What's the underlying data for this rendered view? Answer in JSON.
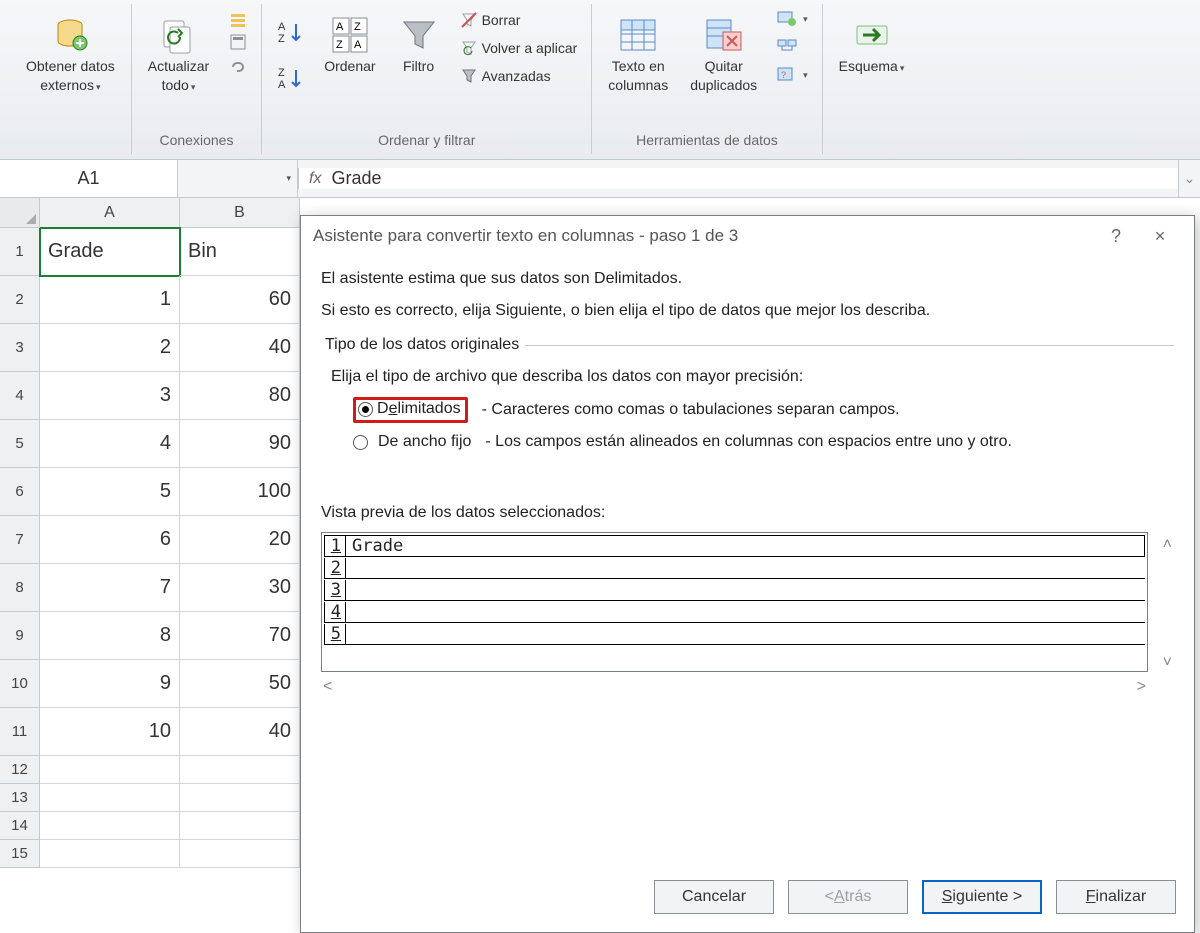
{
  "ribbon": {
    "get_external": {
      "label_l1": "Obtener datos",
      "label_l2": "externos"
    },
    "refresh": {
      "label_l1": "Actualizar",
      "label_l2": "todo"
    },
    "connections_group": "Conexiones",
    "sort_asc": "A↓Z",
    "sort_desc": "Z↓A",
    "sort_btn": "Ordenar",
    "filter_btn": "Filtro",
    "clear": "Borrar",
    "reapply": "Volver a aplicar",
    "advanced": "Avanzadas",
    "sortfilter_group": "Ordenar y filtrar",
    "text_to_cols_l1": "Texto en",
    "text_to_cols_l2": "columnas",
    "remove_dup_l1": "Quitar",
    "remove_dup_l2": "duplicados",
    "datatools_group": "Herramientas de datos",
    "outline": "Esquema"
  },
  "formula_bar": {
    "name_box": "A1",
    "fx_label": "fx",
    "value": "Grade"
  },
  "sheet": {
    "col_headers": [
      "A",
      "B"
    ],
    "rows": [
      {
        "n": "1",
        "a": "Grade",
        "b": "Bin",
        "a_align": "left",
        "b_align": "left",
        "h": "tall"
      },
      {
        "n": "2",
        "a": "1",
        "b": "60",
        "a_align": "right",
        "b_align": "right",
        "h": "tall"
      },
      {
        "n": "3",
        "a": "2",
        "b": "40",
        "a_align": "right",
        "b_align": "right",
        "h": "tall"
      },
      {
        "n": "4",
        "a": "3",
        "b": "80",
        "a_align": "right",
        "b_align": "right",
        "h": "tall"
      },
      {
        "n": "5",
        "a": "4",
        "b": "90",
        "a_align": "right",
        "b_align": "right",
        "h": "tall"
      },
      {
        "n": "6",
        "a": "5",
        "b": "100",
        "a_align": "right",
        "b_align": "right",
        "h": "tall"
      },
      {
        "n": "7",
        "a": "6",
        "b": "20",
        "a_align": "right",
        "b_align": "right",
        "h": "tall"
      },
      {
        "n": "8",
        "a": "7",
        "b": "30",
        "a_align": "right",
        "b_align": "right",
        "h": "tall"
      },
      {
        "n": "9",
        "a": "8",
        "b": "70",
        "a_align": "right",
        "b_align": "right",
        "h": "tall"
      },
      {
        "n": "10",
        "a": "9",
        "b": "50",
        "a_align": "right",
        "b_align": "right",
        "h": "tall"
      },
      {
        "n": "11",
        "a": "10",
        "b": "40",
        "a_align": "right",
        "b_align": "right",
        "h": "tall"
      },
      {
        "n": "12",
        "a": "",
        "b": "",
        "a_align": "left",
        "b_align": "left",
        "h": "short"
      },
      {
        "n": "13",
        "a": "",
        "b": "",
        "a_align": "left",
        "b_align": "left",
        "h": "short"
      },
      {
        "n": "14",
        "a": "",
        "b": "",
        "a_align": "left",
        "b_align": "left",
        "h": "short"
      },
      {
        "n": "15",
        "a": "",
        "b": "",
        "a_align": "left",
        "b_align": "left",
        "h": "short"
      }
    ]
  },
  "dialog": {
    "title": "Asistente para convertir texto en columnas - paso 1 de 3",
    "help": "?",
    "close": "×",
    "intro1": "El asistente estima que sus datos son Delimitados.",
    "intro2": "Si esto es correcto, elija Siguiente, o bien elija el tipo de datos que mejor los describa.",
    "group_title": "Tipo de los datos originales",
    "group_hint": "Elija el tipo de archivo que describa los datos con mayor precisión:",
    "radio_delim_label": "Delimitados",
    "radio_delim_desc": "- Caracteres como comas o tabulaciones separan campos.",
    "radio_fixed_label": "De ancho fijo",
    "radio_fixed_desc": "- Los campos están alineados en columnas con espacios entre uno y otro.",
    "preview_label": "Vista previa de los datos seleccionados:",
    "preview_rows": [
      {
        "n": "1",
        "v": "Grade"
      },
      {
        "n": "2",
        "v": ""
      },
      {
        "n": "3",
        "v": ""
      },
      {
        "n": "4",
        "v": ""
      },
      {
        "n": "5",
        "v": ""
      }
    ],
    "buttons": {
      "cancel": "Cancelar",
      "back": "< Atrás",
      "next": "Siguiente >",
      "finish": "Finalizar"
    }
  }
}
